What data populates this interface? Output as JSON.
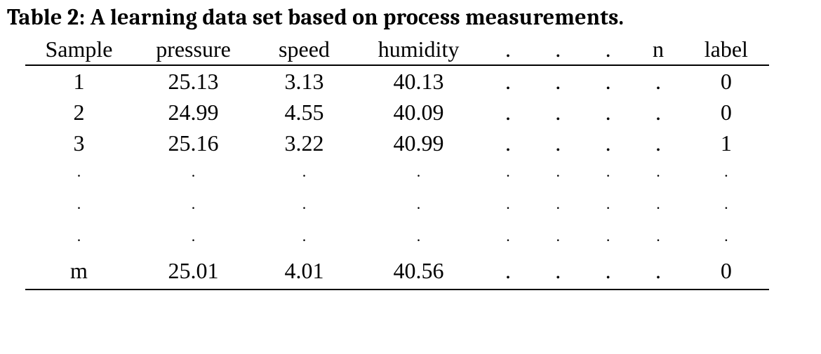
{
  "caption": "Table 2: A learning data set based on process measurements.",
  "headers": {
    "sample": "Sample",
    "pressure": "pressure",
    "speed": "speed",
    "humidity": "humidity",
    "d1": ".",
    "d2": ".",
    "d3": ".",
    "n": "n",
    "label": "label"
  },
  "rows": [
    {
      "sample": "1",
      "pressure": "25.13",
      "speed": "3.13",
      "humidity": "40.13",
      "d1": ".",
      "d2": ".",
      "d3": ".",
      "n": ".",
      "label": "0"
    },
    {
      "sample": "2",
      "pressure": "24.99",
      "speed": "4.55",
      "humidity": "40.09",
      "d1": ".",
      "d2": ".",
      "d3": ".",
      "n": ".",
      "label": "0"
    },
    {
      "sample": "3",
      "pressure": "25.16",
      "speed": "3.22",
      "humidity": "40.99",
      "d1": ".",
      "d2": ".",
      "d3": ".",
      "n": ".",
      "label": "1"
    }
  ],
  "ellipsis_rows": 3,
  "ellipsis_dot": ".",
  "last_row": {
    "sample": "m",
    "pressure": "25.01",
    "speed": "4.01",
    "humidity": "40.56",
    "d1": ".",
    "d2": ".",
    "d3": ".",
    "n": ".",
    "label": "0"
  },
  "chart_data": {
    "type": "table",
    "title": "Table 2: A learning data set based on process measurements.",
    "columns": [
      "Sample",
      "pressure",
      "speed",
      "humidity",
      "...",
      "n",
      "label"
    ],
    "rows": [
      [
        "1",
        25.13,
        3.13,
        40.13,
        "...",
        ".",
        0
      ],
      [
        "2",
        24.99,
        4.55,
        40.09,
        "...",
        ".",
        0
      ],
      [
        "3",
        25.16,
        3.22,
        40.99,
        "...",
        ".",
        1
      ],
      [
        "...",
        "...",
        "...",
        "...",
        "...",
        "...",
        "..."
      ],
      [
        "m",
        25.01,
        4.01,
        40.56,
        "...",
        ".",
        0
      ]
    ]
  }
}
